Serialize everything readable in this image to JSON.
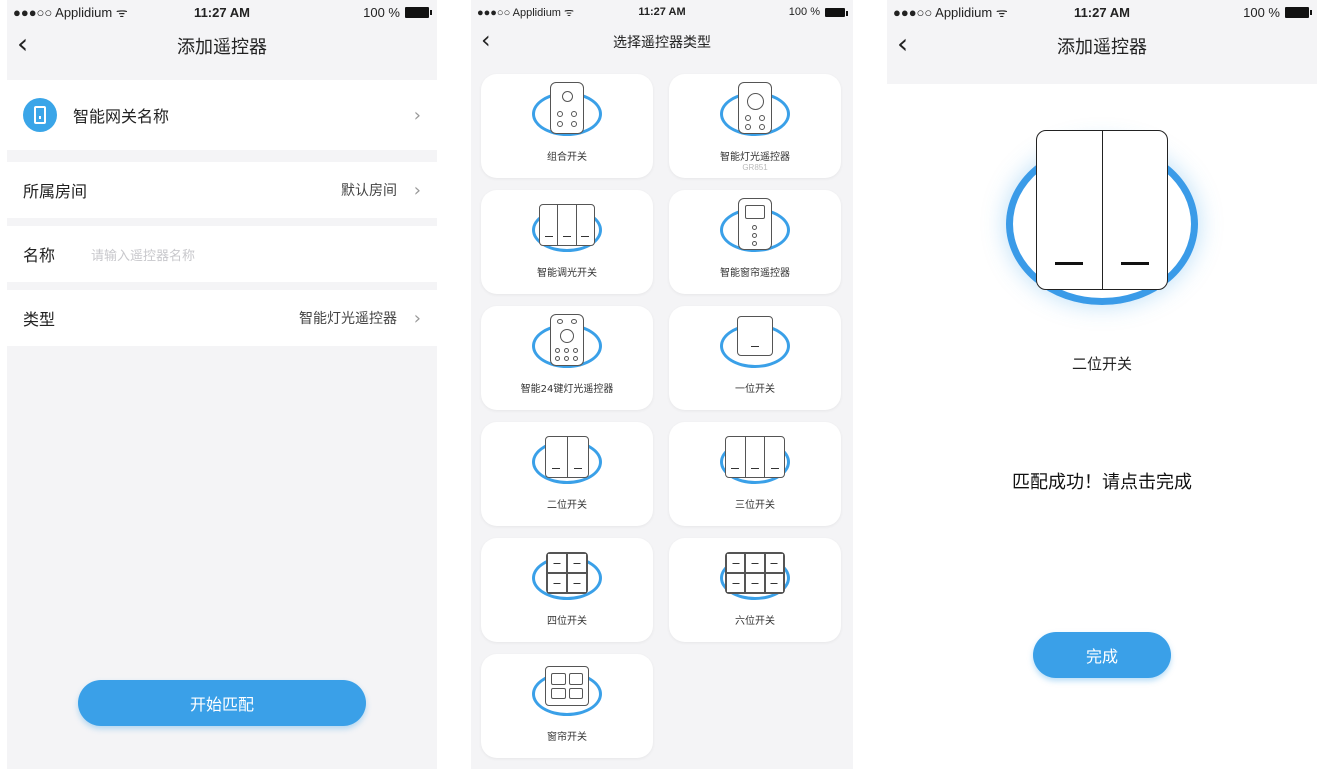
{
  "status_bar": {
    "carrier": "●●●○○ Applidium ᯤ",
    "time": "11:27 AM",
    "battery": "100 %"
  },
  "screen1": {
    "title": "添加遥控器",
    "gateway_name": "智能网关名称",
    "room_label": "所属房间",
    "room_value": "默认房间",
    "name_label": "名称",
    "name_placeholder": "请输入遥控器名称",
    "type_label": "类型",
    "type_value": "智能灯光遥控器",
    "start_button": "开始匹配"
  },
  "screen2": {
    "title": "选择遥控器类型",
    "cards": [
      {
        "label": "组合开关",
        "icon": "remote-combo-icon"
      },
      {
        "label": "智能灯光遥控器",
        "sub": "GR851",
        "icon": "remote-light-icon"
      },
      {
        "label": "智能调光开关",
        "icon": "dimmer-switch-icon"
      },
      {
        "label": "智能窗帘遥控器",
        "icon": "curtain-remote-icon"
      },
      {
        "label": "智能24键灯光遥控器",
        "icon": "remote-24key-icon"
      },
      {
        "label": "一位开关",
        "icon": "switch-1-icon"
      },
      {
        "label": "二位开关",
        "icon": "switch-2-icon"
      },
      {
        "label": "三位开关",
        "icon": "switch-3-icon"
      },
      {
        "label": "四位开关",
        "icon": "switch-4-icon"
      },
      {
        "label": "六位开关",
        "icon": "switch-6-icon"
      },
      {
        "label": "窗帘开关",
        "icon": "curtain-switch-icon"
      }
    ]
  },
  "screen3": {
    "title": "添加遥控器",
    "device_name": "二位开关",
    "success_text": "匹配成功！请点击完成",
    "done_button": "完成"
  },
  "colors": {
    "accent": "#3aa0e8",
    "background": "#f4f4f6"
  }
}
